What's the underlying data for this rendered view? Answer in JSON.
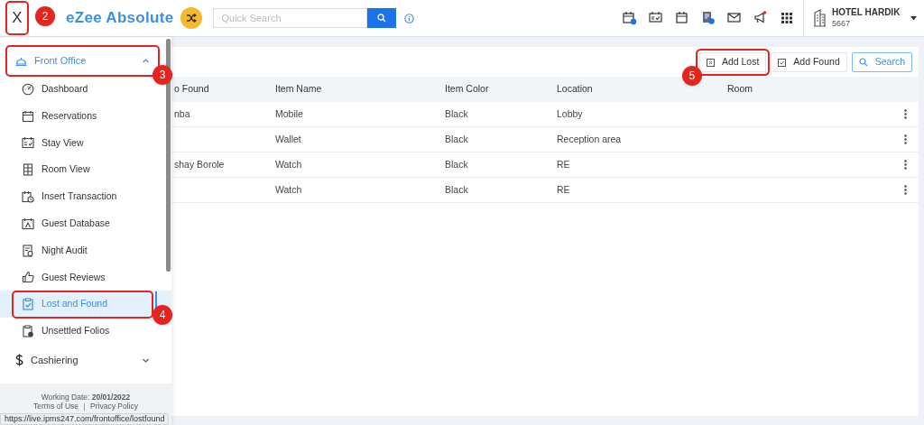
{
  "header": {
    "close_label": "X",
    "close_highlighted": true,
    "close_badge": "2",
    "logo": "eZee Absolute",
    "search": {
      "placeholder": "Quick Search"
    },
    "hotel_name": "HOTEL HARDIK",
    "hotel_code": "5667"
  },
  "sidebar": {
    "sections": [
      {
        "label": "Front Office",
        "expanded": true,
        "highlighted": true,
        "badge": "3",
        "items": [
          {
            "label": "Dashboard",
            "selected": false
          },
          {
            "label": "Reservations",
            "selected": false
          },
          {
            "label": "Stay View",
            "selected": false
          },
          {
            "label": "Room View",
            "selected": false
          },
          {
            "label": "Insert Transaction",
            "selected": false
          },
          {
            "label": "Guest Database",
            "selected": false
          },
          {
            "label": "Night Audit",
            "selected": false
          },
          {
            "label": "Guest Reviews",
            "selected": false
          },
          {
            "label": "Lost and Found",
            "selected": true,
            "highlighted": true,
            "badge": "4"
          },
          {
            "label": "Unsettled Folios",
            "selected": false
          }
        ]
      },
      {
        "label": "Cashiering",
        "expanded": false,
        "highlighted": false
      }
    ],
    "footer": {
      "working_date": "Working Date: **20/01/2022**",
      "links": [
        "Terms of Use",
        "Privacy Policy"
      ]
    }
  },
  "toolbar": [
    {
      "label": "Add Lost",
      "kind": "lost",
      "highlighted": true,
      "badge": "5"
    },
    {
      "label": "Add Found",
      "kind": "found",
      "highlighted": false
    },
    {
      "label": "Search",
      "kind": "search",
      "highlighted": false
    }
  ],
  "table": {
    "columns": [
      "o Found",
      "Item Name",
      "Item Color",
      "Location",
      "Room"
    ],
    "rows": [
      {
        "cells": [
          "nba",
          "Mobile",
          "Black",
          "Lobby"
        ]
      },
      {
        "cells": [
          "",
          "Wallet",
          "Black",
          "Reception area"
        ]
      },
      {
        "cells": [
          "shay Borole",
          "Watch",
          "Black",
          "RE"
        ]
      },
      {
        "cells": [
          "",
          "Watch",
          "Black",
          "RE"
        ]
      }
    ]
  },
  "status_url": "https://live.ipms247.com/frontoffice/lostfound"
}
